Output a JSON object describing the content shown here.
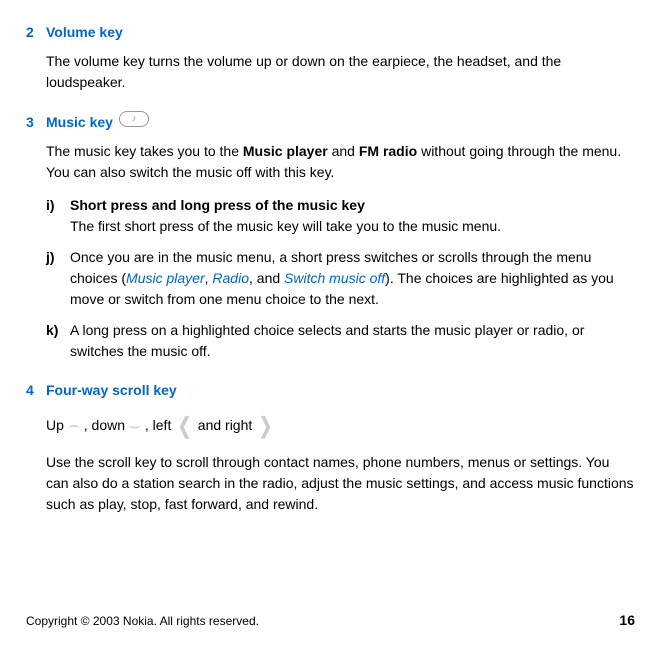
{
  "section2": {
    "num": "2",
    "heading": "Volume key",
    "body": "The volume key turns the volume up or down on the earpiece, the headset, and the loudspeaker."
  },
  "section3": {
    "num": "3",
    "heading": "Music key",
    "body_pre": "The music key takes you to the ",
    "body_b1": "Music player",
    "body_mid1": " and ",
    "body_b2": "FM radio",
    "body_post": " without going through the menu. You can also switch the music off with this key.",
    "items": {
      "i": {
        "marker": "i)",
        "heading": "Short press and long press of the music key",
        "text": "The first short press of the music key will take you to the music menu."
      },
      "j": {
        "marker": "j)",
        "pre": "Once you are in the music menu, a short press switches or scrolls through the menu choices (",
        "link1": "Music player",
        "sep1": ", ",
        "link2": "Radio",
        "sep2": ", and ",
        "link3": "Switch music off",
        "post": "). The choices are highlighted as you move or switch from one menu choice to the next."
      },
      "k": {
        "marker": "k)",
        "text": "A long press on a highlighted choice selects and starts the music player or radio, or switches the music off."
      }
    }
  },
  "section4": {
    "num": "4",
    "heading": "Four-way scroll key",
    "scroll": {
      "up": "Up",
      "down": ", down",
      "left": ", left",
      "right": "and right"
    },
    "body": "Use the scroll key to scroll through contact names, phone numbers, menus or settings. You can also do a station search in the radio, adjust the music settings, and access music functions such as play, stop, fast forward, and rewind."
  },
  "footer": {
    "copyright": "Copyright © 2003 Nokia. All rights reserved.",
    "page": "16"
  }
}
